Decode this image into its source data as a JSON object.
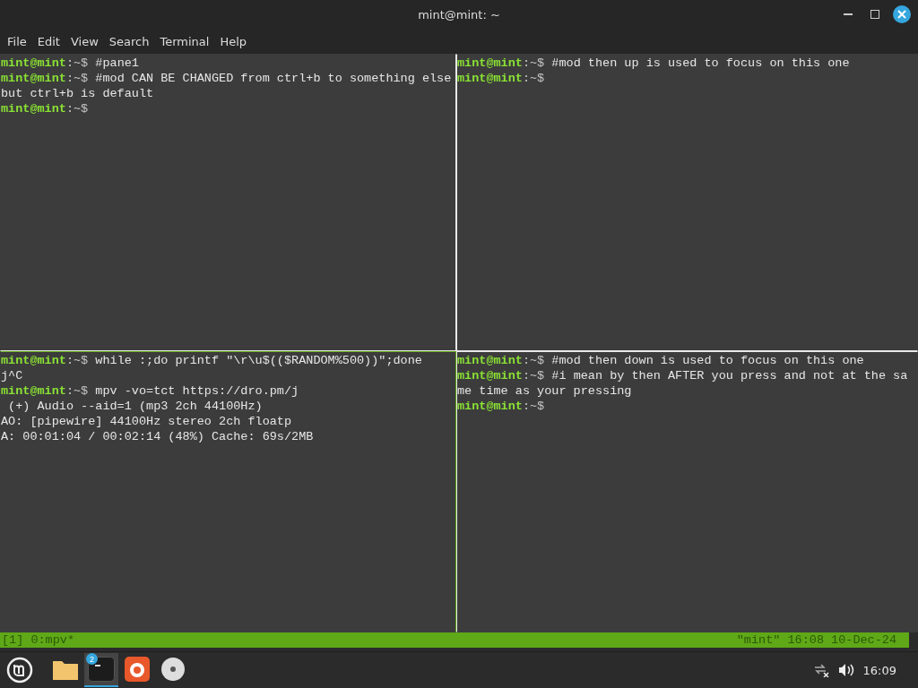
{
  "window": {
    "title": "mint@mint: ~"
  },
  "menu": [
    "File",
    "Edit",
    "View",
    "Search",
    "Terminal",
    "Help"
  ],
  "panes": [
    {
      "active": false,
      "lines": [
        {
          "kind": "prompt",
          "user": "mint@mint",
          "path": ":~$",
          "text": "#pane1"
        },
        {
          "kind": "prompt",
          "user": "mint@mint",
          "path": ":~$",
          "text": "#mod CAN BE CHANGED from ctrl+b to something else"
        },
        {
          "kind": "output",
          "text": "but ctrl+b is default"
        },
        {
          "kind": "prompt",
          "user": "mint@mint",
          "path": ":~$"
        }
      ]
    },
    {
      "active": false,
      "lines": [
        {
          "kind": "prompt",
          "user": "mint@mint",
          "path": ":~$",
          "text": "#mod then up is used to focus on this one"
        },
        {
          "kind": "prompt",
          "user": "mint@mint",
          "path": ":~$"
        }
      ]
    },
    {
      "active": true,
      "lines": [
        {
          "kind": "prompt",
          "user": "mint@mint",
          "path": ":~$",
          "text": "while :;do printf \"\\r\\u$(($RANDOM%500))\";done"
        },
        {
          "kind": "output",
          "text": "j^C"
        },
        {
          "kind": "prompt",
          "user": "mint@mint",
          "path": ":~$",
          "text": "mpv -vo=tct https://dro.pm/j"
        },
        {
          "kind": "output",
          "text": " (+) Audio --aid=1 (mp3 2ch 44100Hz)"
        },
        {
          "kind": "output",
          "text": "AO: [pipewire] 44100Hz stereo 2ch floatp"
        },
        {
          "kind": "output",
          "text": "A: 00:01:04 / 00:02:14 (48%) Cache: 69s/2MB"
        }
      ]
    },
    {
      "active": false,
      "lines": [
        {
          "kind": "prompt",
          "user": "mint@mint",
          "path": ":~$",
          "text": "#mod then down is used to focus on this one"
        },
        {
          "kind": "prompt",
          "user": "mint@mint",
          "path": ":~$",
          "text": "#i mean by then AFTER you press and not at the sa"
        },
        {
          "kind": "output",
          "text": "me time as your pressing"
        },
        {
          "kind": "prompt",
          "user": "mint@mint",
          "path": ":~$"
        }
      ]
    }
  ],
  "status_bar": {
    "left": "[1] 0:mpv*",
    "right": "\"mint\" 16:08 10-Dec-24"
  },
  "taskbar": {
    "apps": [
      {
        "kind": "folder",
        "selected": false
      },
      {
        "kind": "terminal",
        "selected": true,
        "badge": "2"
      },
      {
        "kind": "browser",
        "selected": false
      },
      {
        "kind": "disc",
        "selected": false
      }
    ],
    "clock": "16:09"
  }
}
